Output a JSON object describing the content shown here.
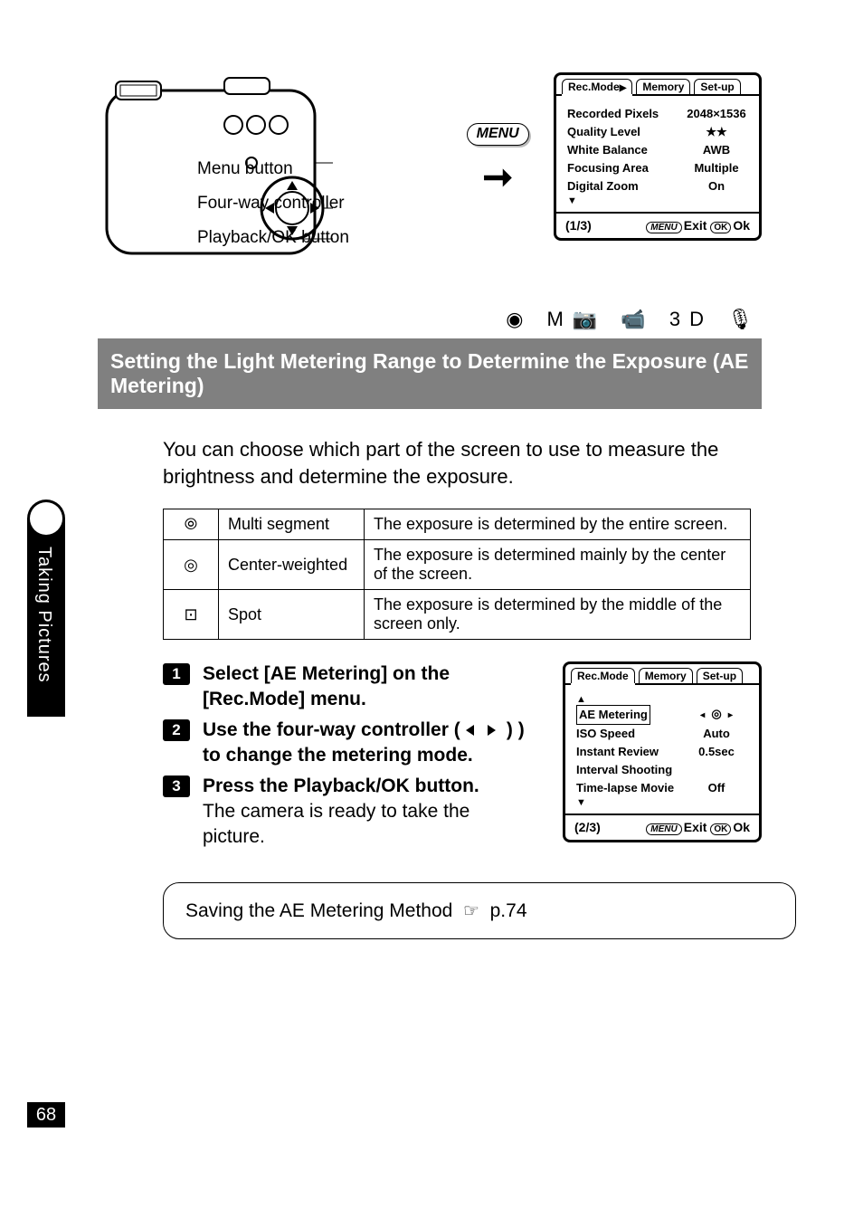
{
  "side_tab": "Taking Pictures",
  "page_number": "68",
  "camera_callouts": {
    "menu": "Menu button",
    "fourway": "Four-way controller",
    "playback": "Playback/OK button"
  },
  "menu_pill": "MENU",
  "lcd1": {
    "tabs": [
      "Rec.Mode",
      "Memory",
      "Set-up"
    ],
    "rows": [
      {
        "label": "Recorded Pixels",
        "value": "2048×1536"
      },
      {
        "label": "Quality Level",
        "value": "★★"
      },
      {
        "label": "White Balance",
        "value": "AWB"
      },
      {
        "label": "Focusing Area",
        "value": "Multiple"
      },
      {
        "label": "Digital Zoom",
        "value": "On"
      }
    ],
    "page": "(1/3)",
    "exit": "Exit",
    "ok": "Ok",
    "menu_small": "MENU",
    "ok_small": "OK"
  },
  "mode_icons_line": "◉  M📷  📹  3D  🎙",
  "section_title": "Setting the Light Metering Range to Determine the Exposure (AE Metering)",
  "intro_para": "You can choose which part of the screen to use to measure the brightness and determine the exposure.",
  "metering_table": [
    {
      "icon": "⦾",
      "name": "Multi segment",
      "desc": "The exposure is determined by the entire screen."
    },
    {
      "icon": "◎",
      "name": "Center-weighted",
      "desc": "The exposure is determined mainly by the center of the screen."
    },
    {
      "icon": "⊡",
      "name": "Spot",
      "desc": "The exposure is determined by the middle of the screen only."
    }
  ],
  "steps": {
    "s1": "Select [AE Metering] on the [Rec.Mode] menu.",
    "s2a": "Use the four-way controller (",
    "s2b": ") to change the metering mode.",
    "s3_bold": "Press the Playback/OK button.",
    "s3_plain": "The camera is ready to take the picture."
  },
  "lcd2": {
    "tabs": [
      "Rec.Mode",
      "Memory",
      "Set-up"
    ],
    "rows": [
      {
        "label": "AE Metering",
        "value": "◎",
        "selected": true
      },
      {
        "label": "ISO Speed",
        "value": "Auto"
      },
      {
        "label": "Instant Review",
        "value": "0.5sec"
      },
      {
        "label": "Interval Shooting",
        "value": ""
      },
      {
        "label": "Time-lapse Movie",
        "value": "Off"
      }
    ],
    "page": "(2/3)",
    "exit": "Exit",
    "ok": "Ok",
    "menu_small": "MENU",
    "ok_small": "OK"
  },
  "memo": {
    "text_a": "Saving the AE Metering Method",
    "page_ref": "p.74"
  }
}
